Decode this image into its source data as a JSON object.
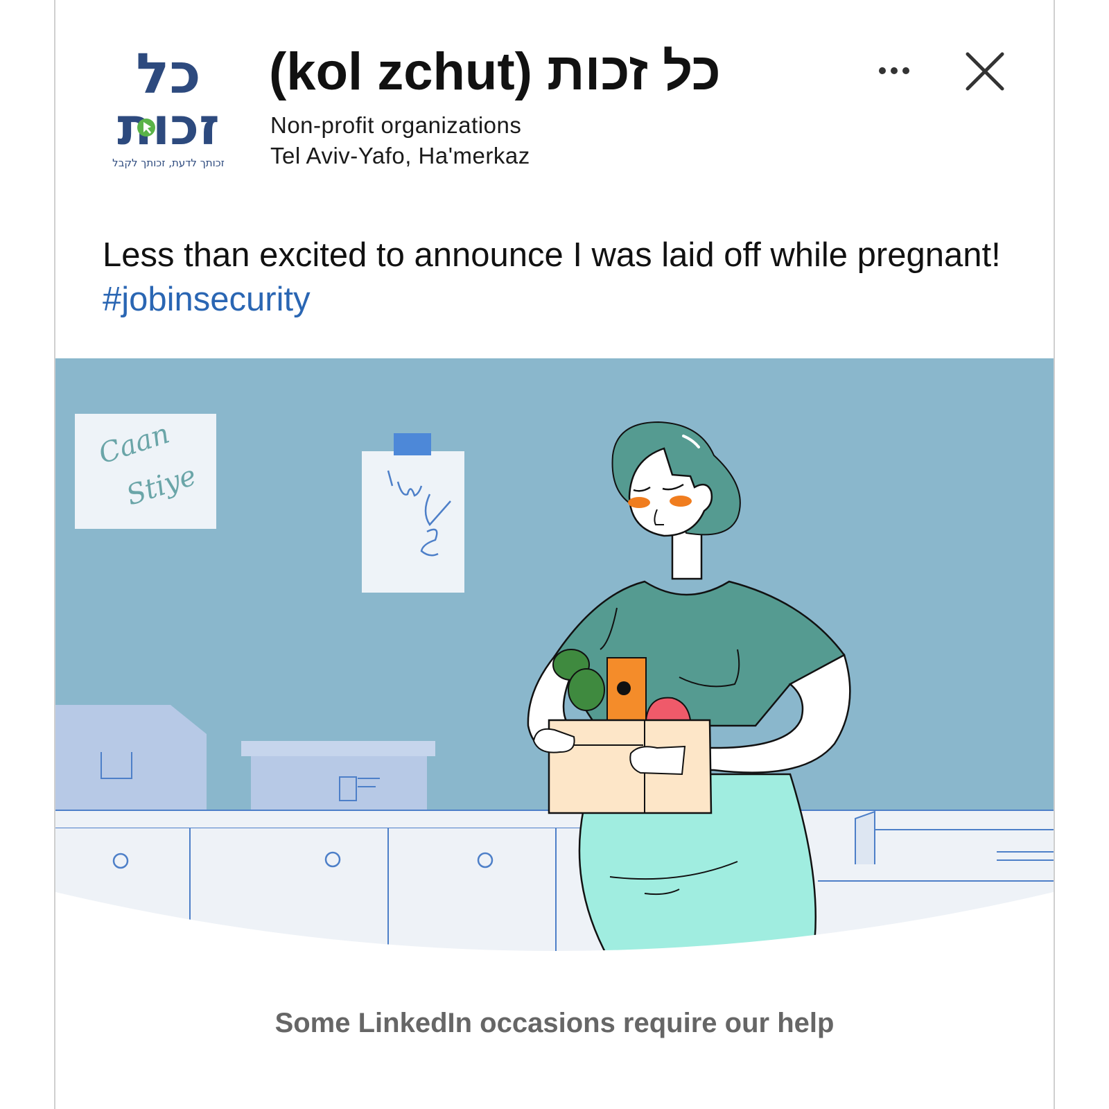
{
  "org": {
    "name": "(kol zchut) כל זכות",
    "category": "Non-profit organizations",
    "location": "Tel Aviv-Yafo, Ha'merkaz"
  },
  "logo": {
    "line1": "כל",
    "line2": "זכות",
    "tagline": "זכותך לדעת, זכותך לקבל",
    "color": "#2d4a7e",
    "accent": "#5ab348"
  },
  "header": {
    "more_icon": "more-horizontal-icon",
    "close_icon": "close-x-icon"
  },
  "post": {
    "text": "Less than excited to announce I was laid off while pregnant! ",
    "hashtag": "#jobinsecurity",
    "hashtag_color": "#2a66b3"
  },
  "illustration": {
    "note_text_1": "Caan",
    "note_text_2": "Stiye",
    "wall_color": "#8ab7cc",
    "shirt_color": "#559b91",
    "skirt_color": "#a0ede0",
    "blush_color": "#f07d1f"
  },
  "footer": {
    "tagline": "Some LinkedIn occasions require our help"
  }
}
